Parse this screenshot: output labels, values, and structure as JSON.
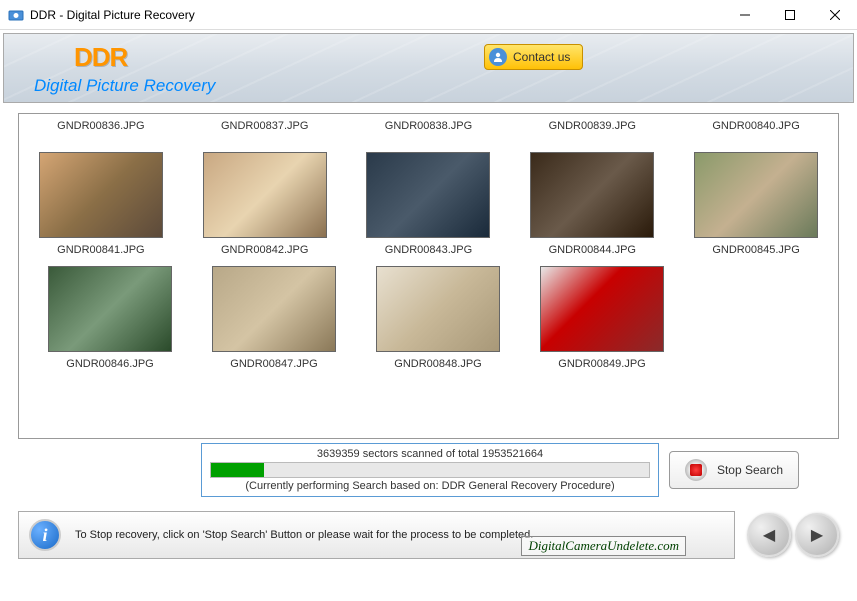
{
  "window": {
    "title": "DDR - Digital Picture Recovery"
  },
  "header": {
    "logo": "DDR",
    "subtitle": "Digital Picture Recovery",
    "contact_label": "Contact us"
  },
  "thumbnails": {
    "row0": [
      "GNDR00836.JPG",
      "GNDR00837.JPG",
      "GNDR00838.JPG",
      "GNDR00839.JPG",
      "GNDR00840.JPG"
    ],
    "row1": [
      "GNDR00841.JPG",
      "GNDR00842.JPG",
      "GNDR00843.JPG",
      "GNDR00844.JPG",
      "GNDR00845.JPG"
    ],
    "row2": [
      "GNDR00846.JPG",
      "GNDR00847.JPG",
      "GNDR00848.JPG",
      "GNDR00849.JPG"
    ]
  },
  "progress": {
    "scanned": "3639359",
    "total": "1953521664",
    "text": "3639359 sectors scanned of total 1953521664",
    "footer": "(Currently performing Search based on:  DDR General Recovery Procedure)"
  },
  "buttons": {
    "stop_label": "Stop Search"
  },
  "footer": {
    "info_text": "To Stop recovery, click on 'Stop Search' Button or please wait for the process to be completed.",
    "watermark": "DigitalCameraUndelete.com"
  }
}
